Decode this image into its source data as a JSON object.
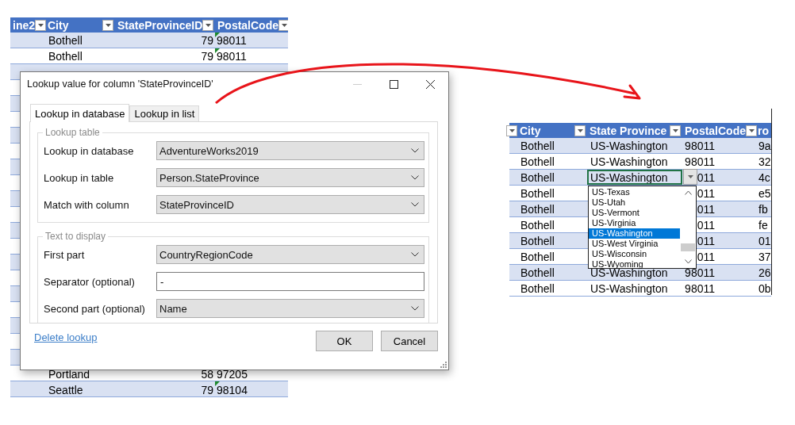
{
  "left_sheet": {
    "columns": [
      {
        "label": "ine2"
      },
      {
        "label": "City"
      },
      {
        "label": "StateProvinceID"
      },
      {
        "label": "PostalCode"
      }
    ],
    "rows_top": [
      {
        "city": "Bothell",
        "id": "79",
        "postal": "98011"
      },
      {
        "city": "Bothell",
        "id": "79",
        "postal": "98011"
      }
    ],
    "rows_bottom": [
      {
        "city": "Portland",
        "id": "58",
        "postal": "97205"
      },
      {
        "city": "Seattle",
        "id": "79",
        "postal": "98104"
      }
    ]
  },
  "dialog": {
    "title": "Lookup value for column 'StateProvinceID'",
    "tabs": [
      {
        "label": "Lookup in database",
        "selected": true
      },
      {
        "label": "Lookup in list",
        "selected": false
      }
    ],
    "groups": [
      {
        "title": "Lookup table",
        "fields": [
          {
            "label": "Lookup in database",
            "kind": "combo",
            "value": "AdventureWorks2019"
          },
          {
            "label": "Lookup in table",
            "kind": "combo",
            "value": "Person.StateProvince"
          },
          {
            "label": "Match with column",
            "kind": "combo",
            "value": "StateProvinceID"
          }
        ]
      },
      {
        "title": "Text to display",
        "fields": [
          {
            "label": "First part",
            "kind": "combo",
            "value": "CountryRegionCode"
          },
          {
            "label": "Separator (optional)",
            "kind": "text",
            "value": "-"
          },
          {
            "label": "Second part (optional)",
            "kind": "combo",
            "value": "Name"
          }
        ]
      }
    ],
    "link": "Delete lookup",
    "buttons": [
      "OK",
      "Cancel"
    ]
  },
  "right_sheet": {
    "columns": [
      {
        "label": "City"
      },
      {
        "label": "State Province"
      },
      {
        "label": "PostalCode"
      },
      {
        "label": "ro"
      }
    ],
    "rows": [
      {
        "city": "Bothell",
        "state": "US-Washington",
        "postal": "98011",
        "column_4": "9a",
        "selected": false
      },
      {
        "city": "Bothell",
        "state": "US-Washington",
        "postal": "98011",
        "column_4": "32",
        "selected": false
      },
      {
        "city": "Bothell",
        "state": "US-Washington",
        "postal": "011",
        "column_4": "4c",
        "selected": true
      },
      {
        "city": "Bothell",
        "postal": "011",
        "column_4": "e5",
        "selected": false
      },
      {
        "city": "Bothell",
        "postal": "011",
        "column_4": "fb",
        "selected": false
      },
      {
        "city": "Bothell",
        "postal": "011",
        "column_4": "fe",
        "selected": false
      },
      {
        "city": "Bothell",
        "postal": "011",
        "column_4": "01",
        "selected": false
      },
      {
        "city": "Bothell",
        "postal": "011",
        "column_4": "37",
        "selected": false
      },
      {
        "city": "Bothell",
        "state": "US-Washington",
        "postal": "98011",
        "column_4": "26",
        "selected": false
      },
      {
        "city": "Bothell",
        "state": "US-Washington",
        "postal": "98011",
        "column_4": "0b",
        "selected": false
      }
    ],
    "dropdown": [
      {
        "label": "US-Texas",
        "selected": false
      },
      {
        "label": "US-Utah",
        "selected": false
      },
      {
        "label": "US-Vermont",
        "selected": false
      },
      {
        "label": "US-Virginia",
        "selected": false
      },
      {
        "label": "US-Washington",
        "selected": true
      },
      {
        "label": "US-West Virginia",
        "selected": false
      },
      {
        "label": "US-Wisconsin",
        "selected": false
      },
      {
        "label": "US-Wyoming",
        "selected": false
      }
    ]
  }
}
